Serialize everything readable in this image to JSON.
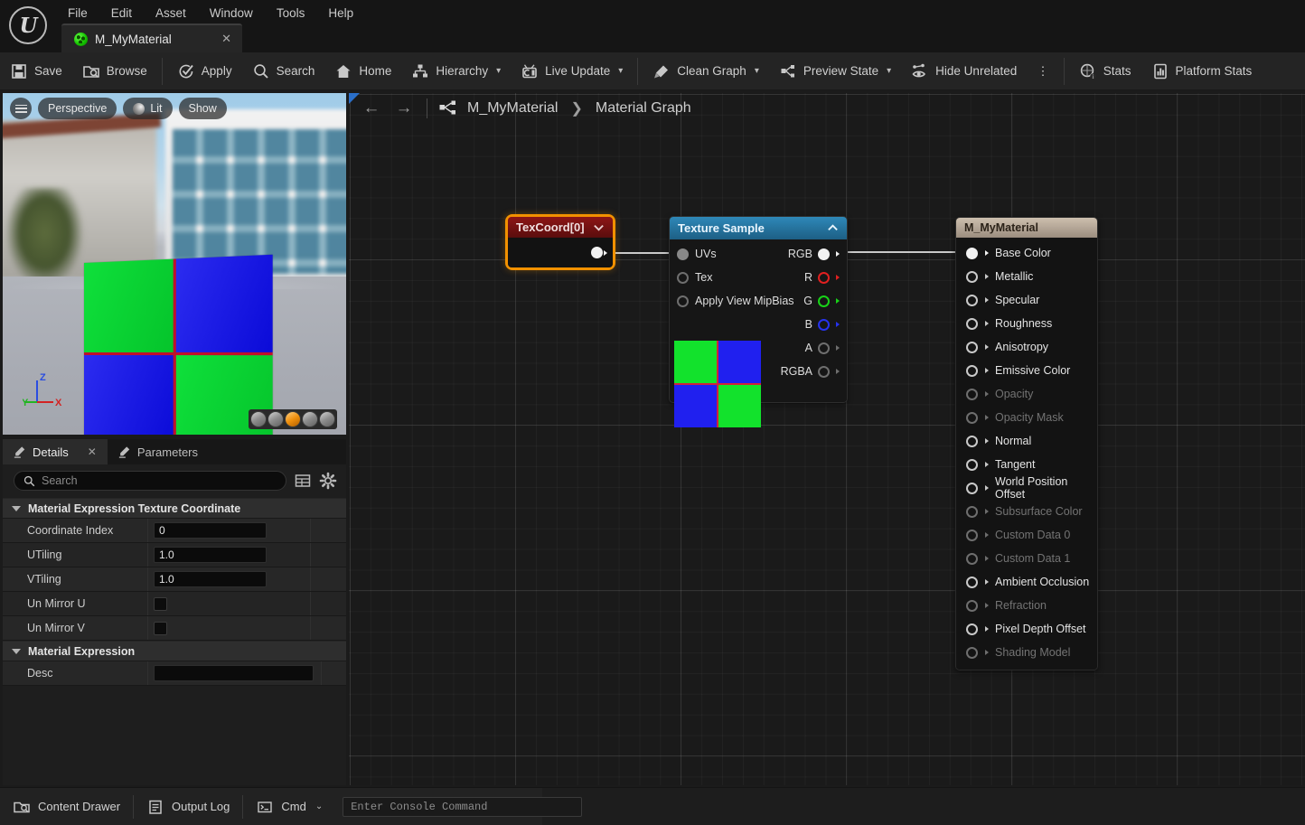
{
  "app": {
    "logo_glyph": "U",
    "menu": [
      "File",
      "Edit",
      "Asset",
      "Window",
      "Tools",
      "Help"
    ],
    "tab": {
      "label": "M_MyMaterial",
      "close": "✕",
      "icon": "material-asset-icon"
    }
  },
  "toolbar": {
    "groups": [
      {
        "items": [
          {
            "label": "Save",
            "icon": "save-icon",
            "caret": false
          },
          {
            "label": "Browse",
            "icon": "browse-icon",
            "caret": false
          }
        ]
      },
      {
        "items": [
          {
            "label": "Apply",
            "icon": "apply-icon",
            "caret": false
          },
          {
            "label": "Search",
            "icon": "search-icon",
            "caret": false
          },
          {
            "label": "Home",
            "icon": "home-icon",
            "caret": false
          },
          {
            "label": "Hierarchy",
            "icon": "hierarchy-icon",
            "caret": true
          },
          {
            "label": "Live Update",
            "icon": "live-update-icon",
            "caret": true
          }
        ]
      },
      {
        "items": [
          {
            "label": "Clean Graph",
            "icon": "clean-graph-icon",
            "caret": true
          },
          {
            "label": "Preview State",
            "icon": "preview-state-icon",
            "caret": true
          },
          {
            "label": "Hide Unrelated",
            "icon": "hide-unrelated-icon",
            "caret": false
          },
          {
            "label": "⋮",
            "icon": "overflow-menu-icon",
            "caret": false
          }
        ]
      },
      {
        "items": [
          {
            "label": "Stats",
            "icon": "stats-icon",
            "caret": false
          },
          {
            "label": "Platform Stats",
            "icon": "platform-stats-icon",
            "caret": false
          }
        ]
      }
    ]
  },
  "viewport": {
    "menu_icon": "viewport-menu-icon",
    "camera_mode": "Perspective",
    "view_mode": "Lit",
    "show_menu": "Show",
    "axis": {
      "x": "X",
      "y": "Y",
      "z": "Z",
      "x_color": "#d32222",
      "y_color": "#22b422",
      "z_color": "#2a4de0"
    },
    "preview_shapes": [
      "cylinder",
      "sphere",
      "plane",
      "cube",
      "custom-mesh"
    ],
    "selected_shape_index": 2
  },
  "details": {
    "tabs": [
      {
        "label": "Details",
        "active": true,
        "closable": true,
        "close": "✕"
      },
      {
        "label": "Parameters",
        "active": false,
        "closable": false,
        "close": ""
      }
    ],
    "search_placeholder": "Search",
    "search_value": "",
    "view_options_icon": "column-view-icon",
    "settings_icon": "gear-icon",
    "categories": [
      {
        "title": "Material Expression Texture Coordinate",
        "expanded": true,
        "rows": [
          {
            "name": "Coordinate Index",
            "type": "text",
            "value": "0"
          },
          {
            "name": "UTiling",
            "type": "text",
            "value": "1.0"
          },
          {
            "name": "VTiling",
            "type": "text",
            "value": "1.0"
          },
          {
            "name": "Un Mirror U",
            "type": "checkbox",
            "value": ""
          },
          {
            "name": "Un Mirror V",
            "type": "checkbox",
            "value": ""
          }
        ]
      },
      {
        "title": "Material Expression",
        "expanded": true,
        "rows": [
          {
            "name": "Desc",
            "type": "wide",
            "value": ""
          }
        ]
      }
    ]
  },
  "graph": {
    "back_arrow": "←",
    "forward_arrow": "→",
    "graph_icon": "material-graph-icon",
    "breadcrumb": {
      "root": "M_MyMaterial",
      "separator": "❯",
      "leaf": "Material Graph"
    },
    "nodes": {
      "texcoord": {
        "title": "TexCoord[0]",
        "collapse_icon": "chevron-down-icon",
        "selected": true,
        "title_color": "#7c1414",
        "selection_color": "#f29100",
        "outputs": [
          {
            "label": "",
            "pin": "filled"
          }
        ]
      },
      "texture_sample": {
        "title": "Texture Sample",
        "collapse_icon": "chevron-up-icon",
        "title_color": "#2a7fae",
        "inputs": [
          {
            "label": "UVs",
            "pin": "gray-fill"
          },
          {
            "label": "Tex",
            "pin": "dim"
          },
          {
            "label": "Apply View MipBias",
            "pin": "dim"
          }
        ],
        "outputs": [
          {
            "label": "RGB",
            "pin": "filled",
            "color": "#f2f2f2"
          },
          {
            "label": "R",
            "pin": "red",
            "color": "#e02020"
          },
          {
            "label": "G",
            "pin": "green",
            "color": "#18d318"
          },
          {
            "label": "B",
            "pin": "blue",
            "color": "#2633ee"
          },
          {
            "label": "A",
            "pin": "dim",
            "color": "#9a9a9a"
          },
          {
            "label": "RGBA",
            "pin": "dim",
            "color": "#c9c9c9"
          }
        ],
        "thumbnail": {
          "name": "texture-preview-thumbnail",
          "quadrants": [
            "#12e22c",
            "#2020ef",
            "#2020ef",
            "#12e22c"
          ],
          "seam_color": "#d0213a"
        }
      },
      "material_output": {
        "title": "M_MyMaterial",
        "inputs": [
          {
            "label": "Base Color",
            "enabled": true,
            "connected": true
          },
          {
            "label": "Metallic",
            "enabled": true,
            "connected": false
          },
          {
            "label": "Specular",
            "enabled": true,
            "connected": false
          },
          {
            "label": "Roughness",
            "enabled": true,
            "connected": false
          },
          {
            "label": "Anisotropy",
            "enabled": true,
            "connected": false
          },
          {
            "label": "Emissive Color",
            "enabled": true,
            "connected": false
          },
          {
            "label": "Opacity",
            "enabled": false,
            "connected": false
          },
          {
            "label": "Opacity Mask",
            "enabled": false,
            "connected": false
          },
          {
            "label": "Normal",
            "enabled": true,
            "connected": false
          },
          {
            "label": "Tangent",
            "enabled": true,
            "connected": false
          },
          {
            "label": "World Position Offset",
            "enabled": true,
            "connected": false
          },
          {
            "label": "Subsurface Color",
            "enabled": false,
            "connected": false
          },
          {
            "label": "Custom Data 0",
            "enabled": false,
            "connected": false
          },
          {
            "label": "Custom Data 1",
            "enabled": false,
            "connected": false
          },
          {
            "label": "Ambient Occlusion",
            "enabled": true,
            "connected": false
          },
          {
            "label": "Refraction",
            "enabled": false,
            "connected": false
          },
          {
            "label": "Pixel Depth Offset",
            "enabled": true,
            "connected": false
          },
          {
            "label": "Shading Model",
            "enabled": false,
            "connected": false
          }
        ]
      }
    }
  },
  "statusbar": {
    "content_drawer": "Content Drawer",
    "output_log": "Output Log",
    "cmd_label": "Cmd",
    "cmd_caret": "⌄",
    "console_placeholder": "Enter Console Command",
    "console_value": ""
  }
}
